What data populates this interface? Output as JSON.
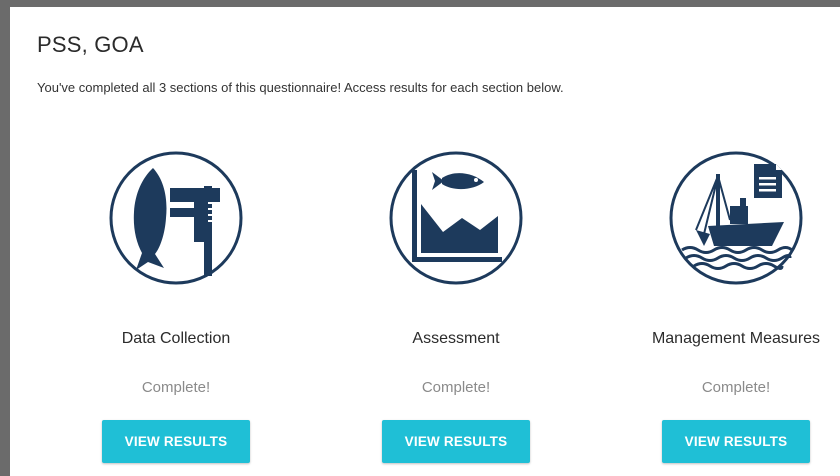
{
  "page": {
    "title": "PSS, GOA",
    "subtitle": "You've completed all 3 sections of this questionnaire! Access results for each section below."
  },
  "sections": [
    {
      "title": "Data Collection",
      "status": "Complete!",
      "button": "VIEW RESULTS",
      "icon": "fish-caliper-icon"
    },
    {
      "title": "Assessment",
      "status": "Complete!",
      "button": "VIEW RESULTS",
      "icon": "fish-chart-icon"
    },
    {
      "title": "Management Measures",
      "status": "Complete!",
      "button": "VIEW RESULTS",
      "icon": "fishing-boat-document-icon"
    }
  ],
  "colors": {
    "accent": "#1fbfd6",
    "icon_navy": "#1d3a5c",
    "background_frame": "#6b6b6b"
  }
}
